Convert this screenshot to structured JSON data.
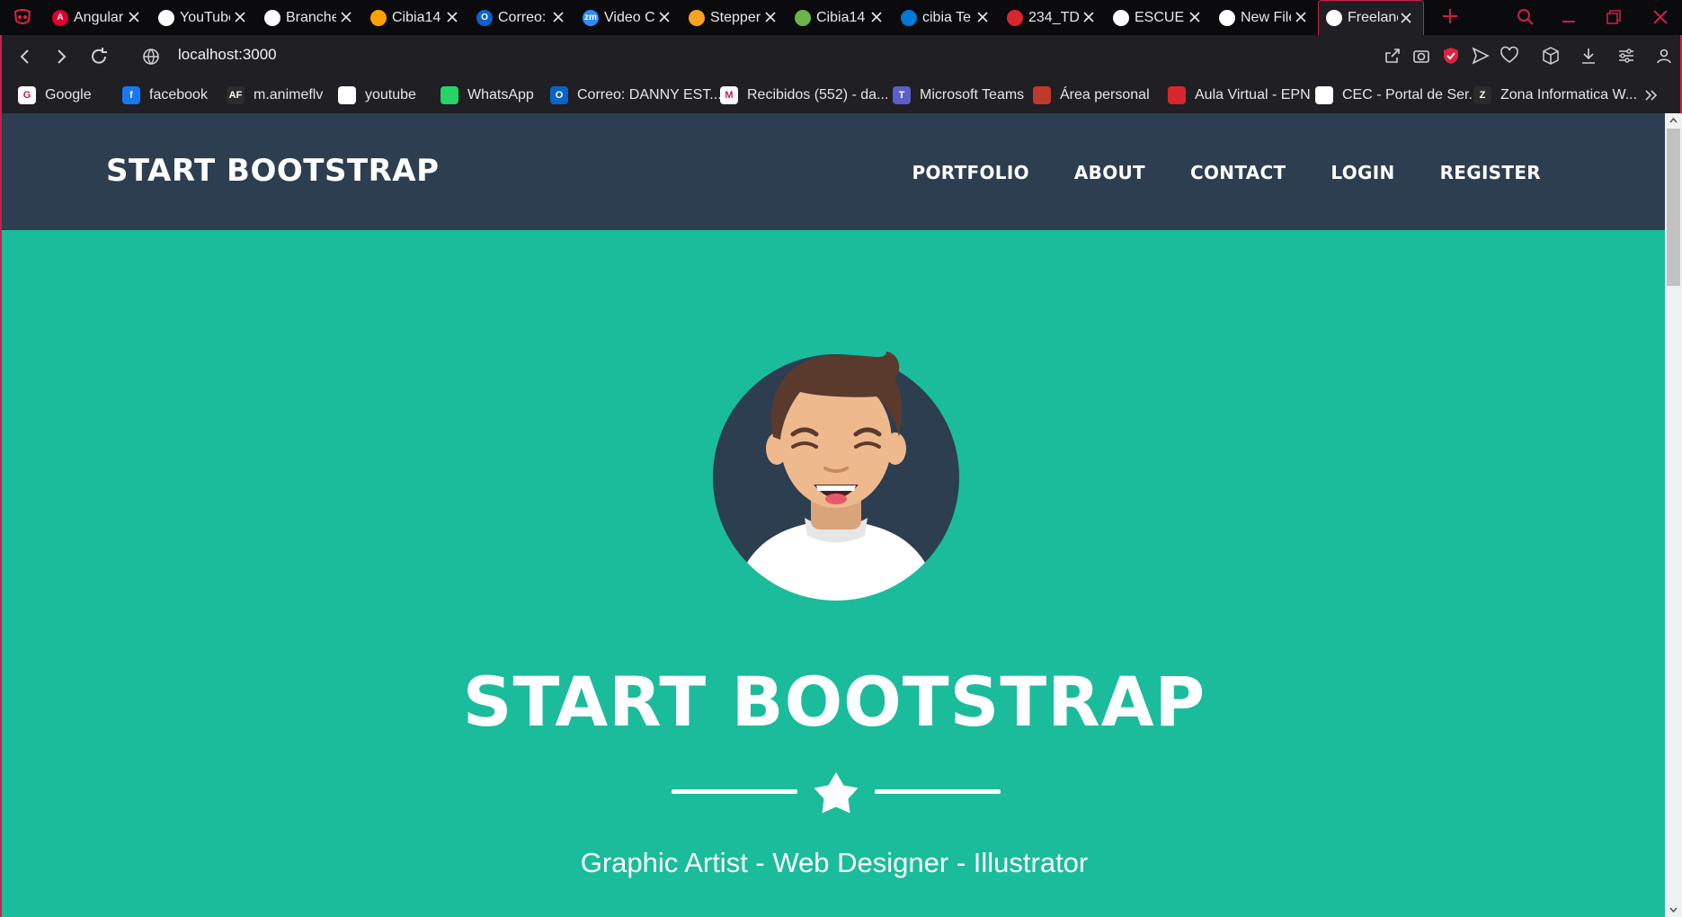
{
  "browser": {
    "tabs": [
      {
        "label": "Angular",
        "favicon": "angular-icon",
        "color": "#dd0031",
        "glyph": "A"
      },
      {
        "label": "YouTube",
        "favicon": "globe-icon",
        "color": "#ffffff",
        "glyph": ""
      },
      {
        "label": "Branches",
        "favicon": "github-icon",
        "color": "#ffffff",
        "glyph": ""
      },
      {
        "label": "Cibia14",
        "favicon": "firebase-icon",
        "color": "#ffa000",
        "glyph": ""
      },
      {
        "label": "Correo:",
        "favicon": "outlook-icon",
        "color": "#0a64c8",
        "glyph": "O"
      },
      {
        "label": "Video C",
        "favicon": "zoom-icon",
        "color": "#2d8cff",
        "glyph": "zm"
      },
      {
        "label": "Stepper",
        "favicon": "stepper-icon",
        "color": "#f6a31e",
        "glyph": ""
      },
      {
        "label": "Cibia14",
        "favicon": "cibia-icon",
        "color": "#6bb64a",
        "glyph": ""
      },
      {
        "label": "cibia Te",
        "favicon": "azure-devops-icon",
        "color": "#0078d4",
        "glyph": ""
      },
      {
        "label": "234_TD",
        "favicon": "epn-icon",
        "color": "#d8262e",
        "glyph": ""
      },
      {
        "label": "ESCUEL",
        "favicon": "globe-icon",
        "color": "#ffffff",
        "glyph": ""
      },
      {
        "label": "New File",
        "favicon": "github-icon",
        "color": "#ffffff",
        "glyph": ""
      },
      {
        "label": "Freelance",
        "favicon": "globe-icon",
        "color": "#ffffff",
        "glyph": ""
      }
    ],
    "active_tab_index": 12,
    "url": "localhost:3000",
    "bookmarks": [
      {
        "label": "Google",
        "icon": "google-icon",
        "color": "#ffffff",
        "glyph": "G"
      },
      {
        "label": "facebook",
        "icon": "facebook-icon",
        "color": "#1877f2",
        "glyph": "f"
      },
      {
        "label": "m.animeflv",
        "icon": "animeflv-icon",
        "color": "#2b2b2b",
        "glyph": "AF"
      },
      {
        "label": "youtube",
        "icon": "document-icon",
        "color": "#ffffff",
        "glyph": ""
      },
      {
        "label": "WhatsApp",
        "icon": "whatsapp-icon",
        "color": "#25d366",
        "glyph": ""
      },
      {
        "label": "Correo: DANNY EST...",
        "icon": "outlook-icon",
        "color": "#0a64c8",
        "glyph": "O"
      },
      {
        "label": "Recibidos (552) - da...",
        "icon": "gmail-icon",
        "color": "#ffffff",
        "glyph": "M"
      },
      {
        "label": "Microsoft Teams",
        "icon": "teams-icon",
        "color": "#5b5fc7",
        "glyph": "T"
      },
      {
        "label": "Área personal",
        "icon": "moodle-icon",
        "color": "#c0392b",
        "glyph": ""
      },
      {
        "label": "Aula Virtual - EPN",
        "icon": "epn-icon",
        "color": "#d8262e",
        "glyph": ""
      },
      {
        "label": "CEC - Portal de Ser...",
        "icon": "cec-icon",
        "color": "#ffffff",
        "glyph": ""
      },
      {
        "label": "Zona Informatica W...",
        "icon": "zona-icon",
        "color": "#2b2b2b",
        "glyph": "Z"
      }
    ]
  },
  "page": {
    "brand": "START BOOTSTRAP",
    "nav": [
      "PORTFOLIO",
      "ABOUT",
      "CONTACT",
      "LOGIN",
      "REGISTER"
    ],
    "hero_title": "START BOOTSTRAP",
    "subtitle": "Graphic Artist - Web Designer - Illustrator",
    "avatar_icon": "avatar-icon",
    "divider_icon": "star-icon"
  },
  "colors": {
    "navbar": "#2c3e50",
    "masthead": "#1abc9c",
    "accent": "#c7214a"
  }
}
